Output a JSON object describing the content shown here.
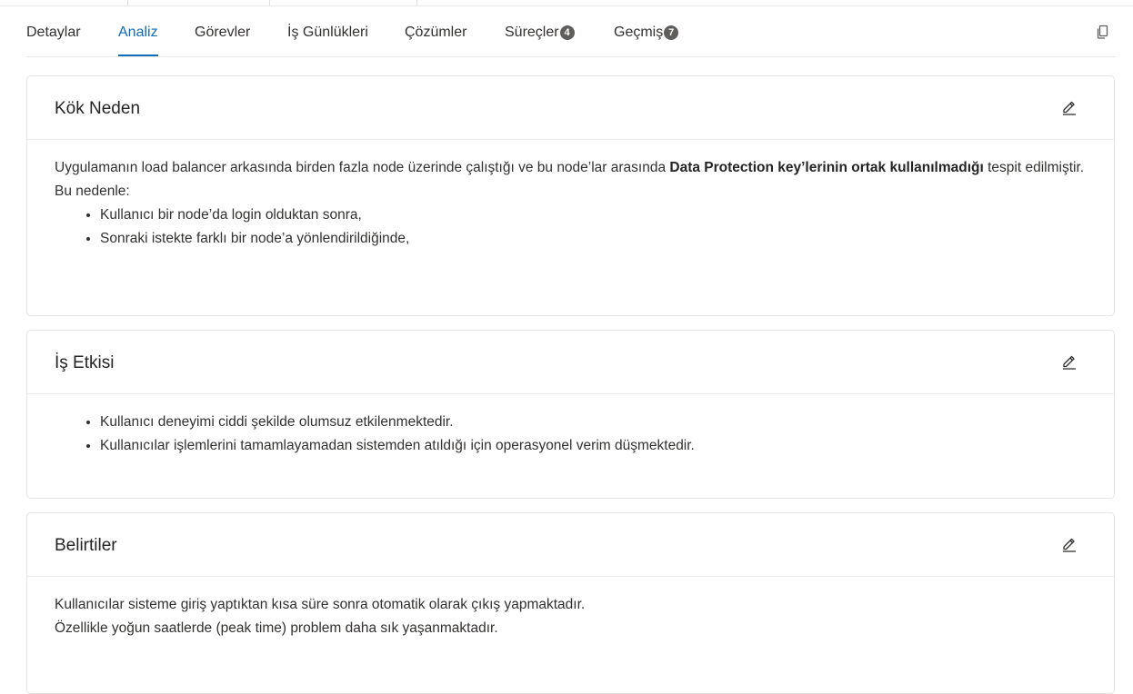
{
  "tabs": [
    {
      "label": "Detaylar",
      "badge": null
    },
    {
      "label": "Analiz",
      "badge": null
    },
    {
      "label": "Görevler",
      "badge": null
    },
    {
      "label": "İş Günlükleri",
      "badge": null
    },
    {
      "label": "Çözümler",
      "badge": null
    },
    {
      "label": "Süreçler",
      "badge": "4"
    },
    {
      "label": "Geçmiş",
      "badge": "7"
    }
  ],
  "active_tab": "Analiz",
  "cards": {
    "root_cause": {
      "title": "Kök Neden",
      "text_before": "Uygulamanın load balancer arkasında birden fazla node üzerinde çalıştığı ve bu node’lar arasında ",
      "text_bold": "Data Protection key’lerinin ortak kullanılmadığı",
      "text_after": " tespit edilmiştir.",
      "line2": "Bu nedenle:",
      "bullets": [
        "Kullanıcı bir node’da login olduktan sonra,",
        "Sonraki istekte farklı bir node’a yönlendirildiğinde,"
      ]
    },
    "business_impact": {
      "title": "İş Etkisi",
      "bullets": [
        "Kullanıcı deneyimi ciddi şekilde olumsuz etkilenmektedir.",
        "Kullanıcılar işlemlerini tamamlayamadan sistemden atıldığı için operasyonel verim düşmektedir."
      ]
    },
    "symptoms": {
      "title": "Belirtiler",
      "lines": [
        "Kullanıcılar sisteme giriş yaptıktan kısa süre sonra otomatik olarak çıkış yapmaktadır.",
        "Özellikle yoğun saatlerde (peak time) problem daha sık yaşanmaktadır."
      ]
    }
  },
  "colors": {
    "accent": "#0f6cbd",
    "badge": "#605e5c",
    "text": "#323130"
  },
  "icons": {
    "copy": "copy-icon",
    "edit": "pencil-edit-icon"
  }
}
